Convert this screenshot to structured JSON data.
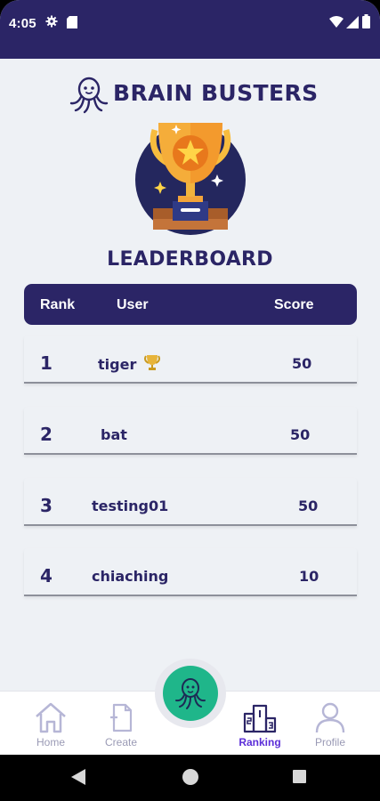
{
  "status_bar": {
    "time": "4:05",
    "icons": [
      "gear-icon",
      "sd-card-icon",
      "wifi-icon",
      "signal-icon",
      "battery-icon"
    ]
  },
  "header": {
    "title": "BRAIN BUSTERS",
    "logo_icon": "octopus-icon"
  },
  "hero": {
    "image": "trophy-illustration"
  },
  "leaderboard": {
    "heading": "LEADERBOARD",
    "columns": {
      "rank": "Rank",
      "user": "User",
      "score": "Score"
    },
    "rows": [
      {
        "rank": "1",
        "user": "tiger",
        "score": "50",
        "badge": "trophy-icon"
      },
      {
        "rank": "2",
        "user": "bat",
        "score": "50"
      },
      {
        "rank": "3",
        "user": "testing01",
        "score": "50"
      },
      {
        "rank": "4",
        "user": "chiaching",
        "score": "10"
      }
    ]
  },
  "bottom_nav": {
    "items": [
      {
        "label": "Home",
        "icon": "home-icon"
      },
      {
        "label": "Create",
        "icon": "create-icon"
      },
      {
        "label": "Ranking",
        "icon": "podium-icon",
        "active": true
      },
      {
        "label": "Profile",
        "icon": "profile-icon"
      }
    ],
    "fab_icon": "octopus-icon"
  },
  "colors": {
    "primary": "#2b2566",
    "accent": "#1fb68a",
    "active_nav": "#5b2dd8",
    "background": "#eef1f5"
  }
}
